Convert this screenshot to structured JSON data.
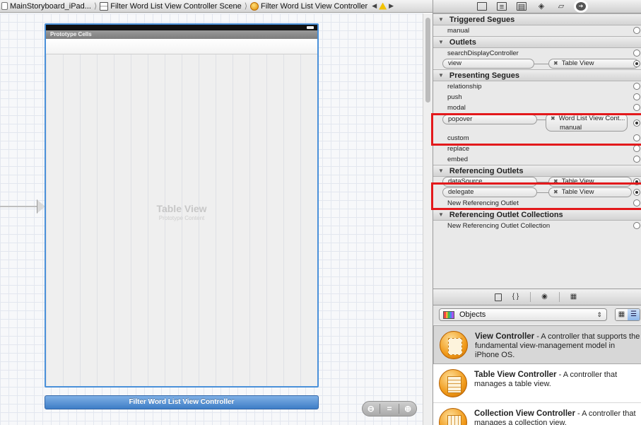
{
  "jumpbar": {
    "crumbs": [
      "MainStoryboard_iPad...",
      "Filter Word List View Controller Scene",
      "Filter Word List View Controller"
    ],
    "separator": "⟩"
  },
  "canvas": {
    "prototype_header": "Prototype Cells",
    "table_title": "Table View",
    "table_subtitle": "Prototype Content",
    "scene_label": "Filter Word List View Controller"
  },
  "inspector": {
    "sections": {
      "triggered_segues": {
        "title": "Triggered Segues",
        "rows": [
          "manual"
        ]
      },
      "outlets": {
        "title": "Outlets",
        "rows": [
          "searchDisplayController"
        ],
        "connected": [
          {
            "name": "view",
            "target": "Table View"
          }
        ]
      },
      "presenting_segues": {
        "title": "Presenting Segues",
        "rows_before": [
          "relationship",
          "push",
          "modal"
        ],
        "connected": {
          "name": "popover",
          "target": "Word List View Cont...",
          "target_sub": "manual"
        },
        "rows_after": [
          "custom",
          "replace",
          "embed"
        ]
      },
      "referencing_outlets": {
        "title": "Referencing Outlets",
        "connected": [
          {
            "name": "dataSource",
            "target": "Table View"
          },
          {
            "name": "delegate",
            "target": "Table View"
          }
        ],
        "new_label": "New Referencing Outlet"
      },
      "referencing_outlet_collections": {
        "title": "Referencing Outlet Collections",
        "new_label": "New Referencing Outlet Collection"
      }
    }
  },
  "library": {
    "filter_value": "Objects",
    "items": [
      {
        "title": "View Controller",
        "desc": " - A controller that supports the fundamental view-management model in iPhone OS."
      },
      {
        "title": "Table View Controller",
        "desc": " - A controller that manages a table view."
      },
      {
        "title": "Collection View Controller",
        "desc": " - A controller that manages a collection view."
      }
    ]
  },
  "colors": {
    "accent_blue": "#4a90d9",
    "highlight_red": "#e3191c"
  }
}
